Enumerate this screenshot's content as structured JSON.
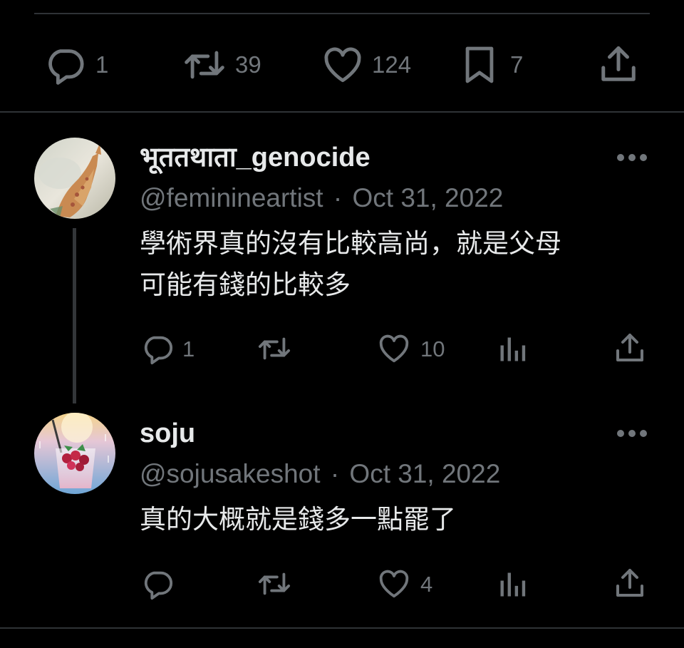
{
  "main_tweet_actions": {
    "replies": "1",
    "retweets": "39",
    "likes": "124",
    "bookmarks": "7"
  },
  "replies": [
    {
      "display_name": "भूततथाता_genocide",
      "handle": "@feminineartist",
      "separator": "·",
      "date": "Oct 31, 2022",
      "text_line1": "學術界真的沒有比較高尚，就是父母",
      "text_line2": "可能有錢的比較多",
      "reply_count": "1",
      "retweet_count": "",
      "like_count": "10"
    },
    {
      "display_name": "soju",
      "handle": "@sojusakeshot",
      "separator": "·",
      "date": "Oct 31, 2022",
      "text_line1": "真的大概就是錢多一點罷了",
      "reply_count": "",
      "retweet_count": "",
      "like_count": "4"
    }
  ],
  "icons": [
    "reply-icon",
    "retweet-icon",
    "like-icon",
    "bookmark-icon",
    "share-icon",
    "views-icon",
    "more-icon"
  ],
  "colors": {
    "background": "#000000",
    "text": "#e7e9ea",
    "muted": "#71767b",
    "divider": "#2f3336"
  }
}
